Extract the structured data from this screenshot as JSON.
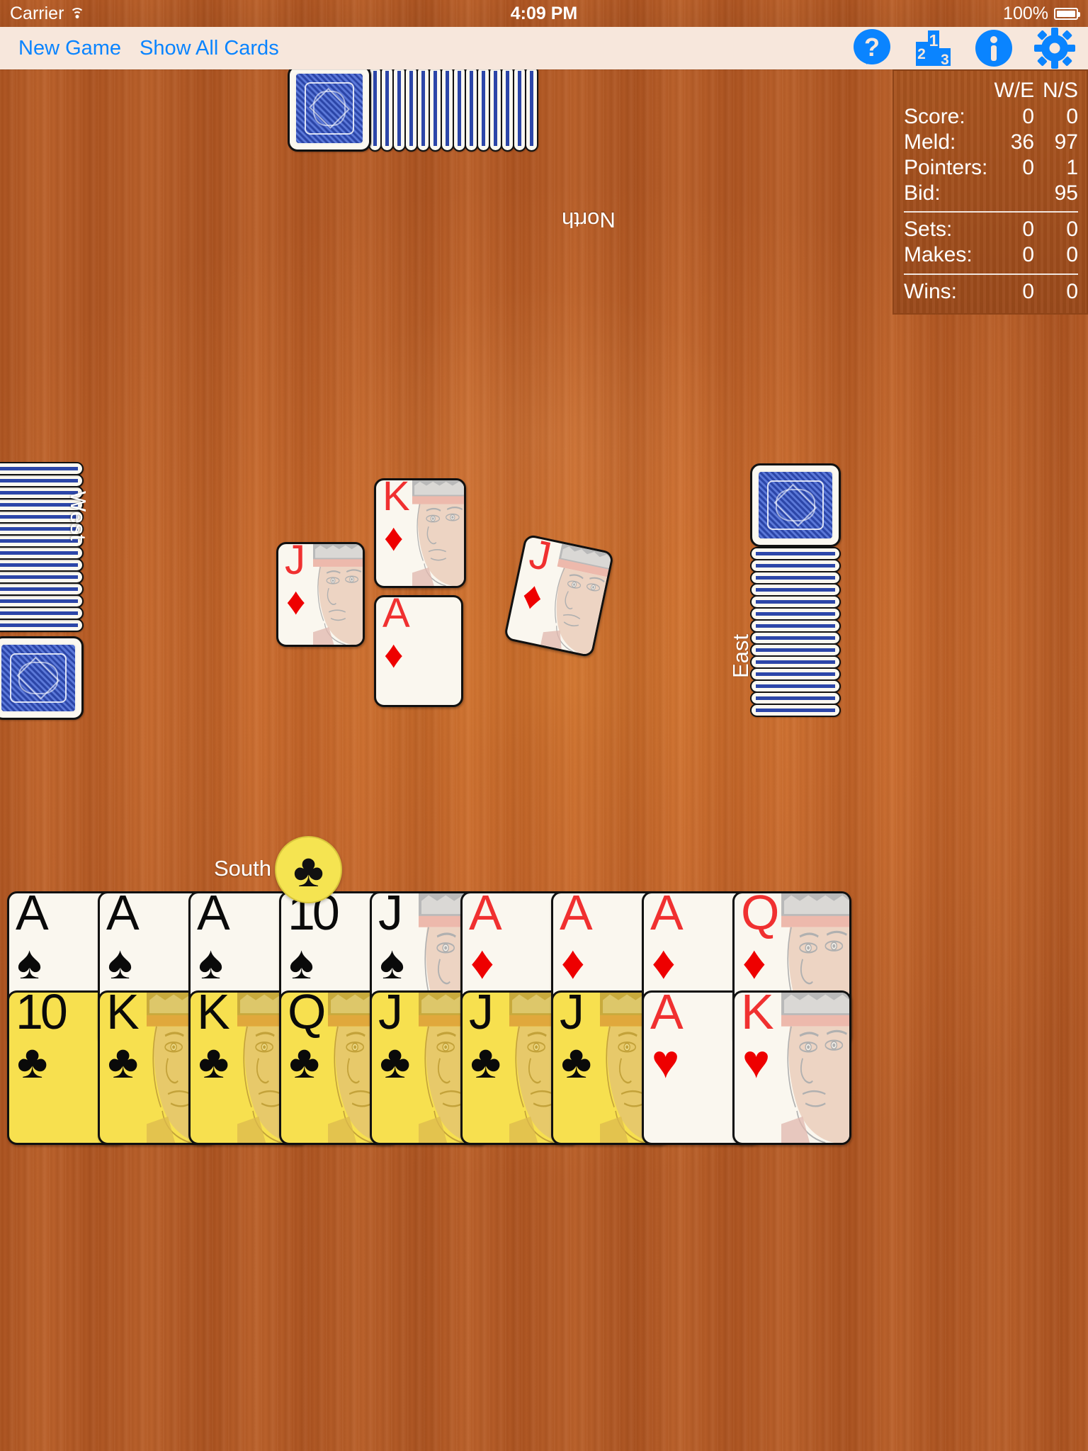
{
  "status_bar": {
    "carrier": "Carrier",
    "wifi_icon": "wifi-icon",
    "time": "4:09 PM",
    "battery_percent": "100%",
    "battery_icon": "battery-full-icon"
  },
  "toolbar": {
    "new_game_label": "New Game",
    "show_all_cards_label": "Show All Cards",
    "icons": [
      {
        "name": "help-icon",
        "glyph": "?"
      },
      {
        "name": "leaderboard-icon",
        "glyph": "2 1 3"
      },
      {
        "name": "info-icon",
        "glyph": "i"
      },
      {
        "name": "settings-gear-icon",
        "glyph": "gear"
      }
    ]
  },
  "scoreboard": {
    "col_headers": [
      "W/E",
      "N/S"
    ],
    "rows": [
      {
        "label": "Score:",
        "we": "0",
        "ns": "0"
      },
      {
        "label": "Meld:",
        "we": "36",
        "ns": "97"
      },
      {
        "label": "Pointers:",
        "we": "0",
        "ns": "1"
      },
      {
        "label": "Bid:",
        "we": "",
        "ns": "95"
      }
    ],
    "rows2": [
      {
        "label": "Sets:",
        "we": "0",
        "ns": "0"
      },
      {
        "label": "Makes:",
        "we": "0",
        "ns": "0"
      }
    ],
    "rows3": [
      {
        "label": "Wins:",
        "we": "0",
        "ns": "0"
      }
    ]
  },
  "seats": {
    "north": "North",
    "west": "West",
    "east": "East",
    "south": "South"
  },
  "trump": {
    "suit": "♣",
    "name": "clubs"
  },
  "trick": [
    {
      "position": "north",
      "rank": "K",
      "suit": "♦",
      "color": "red",
      "court": true,
      "rotation": 0
    },
    {
      "position": "west",
      "rank": "J",
      "suit": "♦",
      "color": "red",
      "court": true,
      "rotation": 0
    },
    {
      "position": "south",
      "rank": "A",
      "suit": "♦",
      "color": "red",
      "court": false,
      "rotation": 0
    },
    {
      "position": "east",
      "rank": "J",
      "suit": "♦",
      "color": "red",
      "court": true,
      "rotation": 12
    }
  ],
  "hand": {
    "top_row": [
      {
        "rank": "A",
        "suit": "♠",
        "color": "black",
        "court": false,
        "highlight": false
      },
      {
        "rank": "A",
        "suit": "♠",
        "color": "black",
        "court": false,
        "highlight": false
      },
      {
        "rank": "A",
        "suit": "♠",
        "color": "black",
        "court": false,
        "highlight": false
      },
      {
        "rank": "10",
        "suit": "♠",
        "color": "black",
        "court": false,
        "highlight": false
      },
      {
        "rank": "J",
        "suit": "♠",
        "color": "black",
        "court": true,
        "highlight": false
      },
      {
        "rank": "A",
        "suit": "♦",
        "color": "red",
        "court": false,
        "highlight": false
      },
      {
        "rank": "A",
        "suit": "♦",
        "color": "red",
        "court": false,
        "highlight": false
      },
      {
        "rank": "A",
        "suit": "♦",
        "color": "red",
        "court": false,
        "highlight": false
      },
      {
        "rank": "Q",
        "suit": "♦",
        "color": "red",
        "court": true,
        "highlight": false
      }
    ],
    "bottom_row": [
      {
        "rank": "10",
        "suit": "♣",
        "color": "black",
        "court": false,
        "highlight": true
      },
      {
        "rank": "K",
        "suit": "♣",
        "color": "black",
        "court": true,
        "highlight": true
      },
      {
        "rank": "K",
        "suit": "♣",
        "color": "black",
        "court": true,
        "highlight": true
      },
      {
        "rank": "Q",
        "suit": "♣",
        "color": "black",
        "court": true,
        "highlight": true
      },
      {
        "rank": "J",
        "suit": "♣",
        "color": "black",
        "court": true,
        "highlight": true
      },
      {
        "rank": "J",
        "suit": "♣",
        "color": "black",
        "court": true,
        "highlight": true
      },
      {
        "rank": "J",
        "suit": "♣",
        "color": "black",
        "court": true,
        "highlight": true
      },
      {
        "rank": "A",
        "suit": "♥",
        "color": "red",
        "court": false,
        "highlight": false
      },
      {
        "rank": "K",
        "suit": "♥",
        "color": "red",
        "court": true,
        "highlight": false
      }
    ]
  },
  "opponent_stacks": {
    "north_count": 14,
    "west_count": 14,
    "east_count": 14
  },
  "colors": {
    "accent": "#0a84ff",
    "table": "#c46a2b",
    "toolbar_bg": "#f7e7dc",
    "scoreboard_bg": "#a9541f",
    "card_face": "#faf7ef",
    "card_highlight": "#f7e04f",
    "card_back_blue": "#27409c",
    "red_suit": "#ee0000",
    "trump_badge": "#f5e451"
  }
}
